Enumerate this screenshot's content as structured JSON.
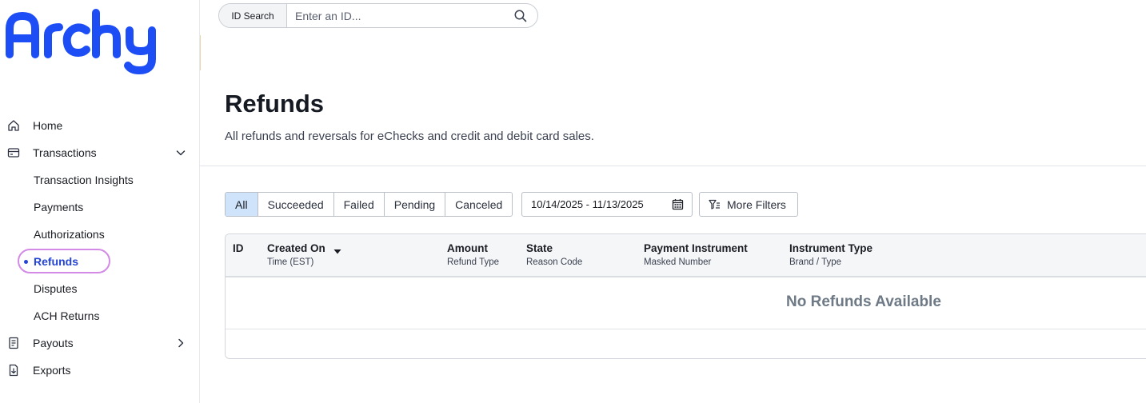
{
  "app": {
    "logo_text": "Archy",
    "brand_color": "#1d4ef5"
  },
  "search": {
    "tag_label": "ID Search",
    "placeholder": "Enter an ID...",
    "value": ""
  },
  "sidebar": {
    "items": [
      {
        "label": "Home",
        "icon": "home-icon"
      },
      {
        "label": "Transactions",
        "icon": "transactions-icon",
        "expanded": true
      },
      {
        "label": "Payouts",
        "icon": "payouts-icon",
        "expanded": false
      },
      {
        "label": "Exports",
        "icon": "exports-icon"
      }
    ],
    "transactions_subitems": [
      {
        "label": "Transaction Insights"
      },
      {
        "label": "Payments"
      },
      {
        "label": "Authorizations"
      },
      {
        "label": "Refunds",
        "active": true
      },
      {
        "label": "Disputes"
      },
      {
        "label": "ACH Returns"
      }
    ]
  },
  "page": {
    "title": "Refunds",
    "subtitle": "All refunds and reversals for eChecks and credit and debit card sales."
  },
  "filters": {
    "status_tabs": [
      "All",
      "Succeeded",
      "Failed",
      "Pending",
      "Canceled"
    ],
    "active_status": "All",
    "date_range": "10/14/2025 - 11/13/2025",
    "more_filters_label": "More Filters"
  },
  "table": {
    "columns": [
      {
        "label": "ID",
        "sublabel": ""
      },
      {
        "label": "Created On",
        "sublabel": "Time (EST)",
        "sorted": "desc"
      },
      {
        "label": "Amount",
        "sublabel": "Refund Type"
      },
      {
        "label": "State",
        "sublabel": "Reason Code"
      },
      {
        "label": "Payment Instrument",
        "sublabel": "Masked Number"
      },
      {
        "label": "Instrument Type",
        "sublabel": "Brand / Type"
      }
    ],
    "rows": [],
    "empty_message": "No Refunds Available"
  },
  "colors": {
    "active_accent": "#2344d6",
    "active_tab_bg": "#cfe3fb",
    "highlight_ring": "#d38ae6"
  }
}
